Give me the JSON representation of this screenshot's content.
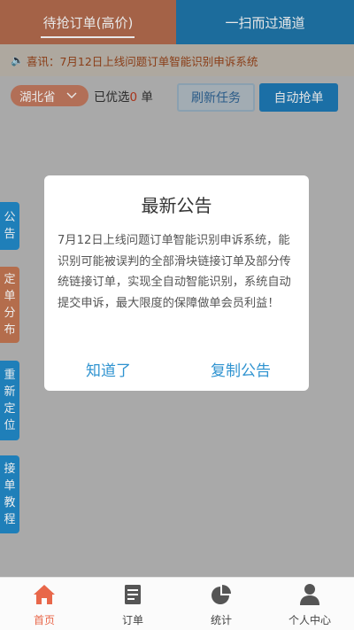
{
  "top_tabs": [
    {
      "label": "待抢订单(高价)",
      "active": true
    },
    {
      "label": "一扫而过通道",
      "active": false
    }
  ],
  "notice": {
    "icon": "speaker-icon",
    "text": "喜讯：7月12日上线问题订单智能识别申诉系统"
  },
  "filter": {
    "province": "湖北省",
    "selected_prefix": "已优选",
    "selected_count": "0",
    "selected_suffix": " 单",
    "refresh_label": "刷新任务",
    "auto_label": "自动抢单"
  },
  "side_tabs": [
    {
      "chars": [
        "公",
        "告"
      ]
    },
    {
      "chars": [
        "定",
        "单",
        "分",
        "布"
      ]
    },
    {
      "chars": [
        "重",
        "新",
        "定",
        "位"
      ]
    },
    {
      "chars": [
        "接",
        "单",
        "教",
        "程"
      ]
    }
  ],
  "modal": {
    "title": "最新公告",
    "body": "7月12日上线问题订单智能识别申诉系统，能识别可能被误判的全部滑块链接订单及部分传统链接订单，实现全自动智能识别，系统自动提交申诉，最大限度的保障做单会员利益！",
    "confirm_label": "知道了",
    "copy_label": "复制公告"
  },
  "bottom_nav": [
    {
      "label": "首页",
      "icon": "home-icon",
      "active": true
    },
    {
      "label": "订单",
      "icon": "document-icon",
      "active": false
    },
    {
      "label": "统计",
      "icon": "pie-chart-icon",
      "active": false
    },
    {
      "label": "个人中心",
      "icon": "user-icon",
      "active": false
    }
  ],
  "colors": {
    "accent_orange": "#e8674a",
    "accent_blue": "#1f7fb9",
    "modal_link": "#2f93d0"
  }
}
